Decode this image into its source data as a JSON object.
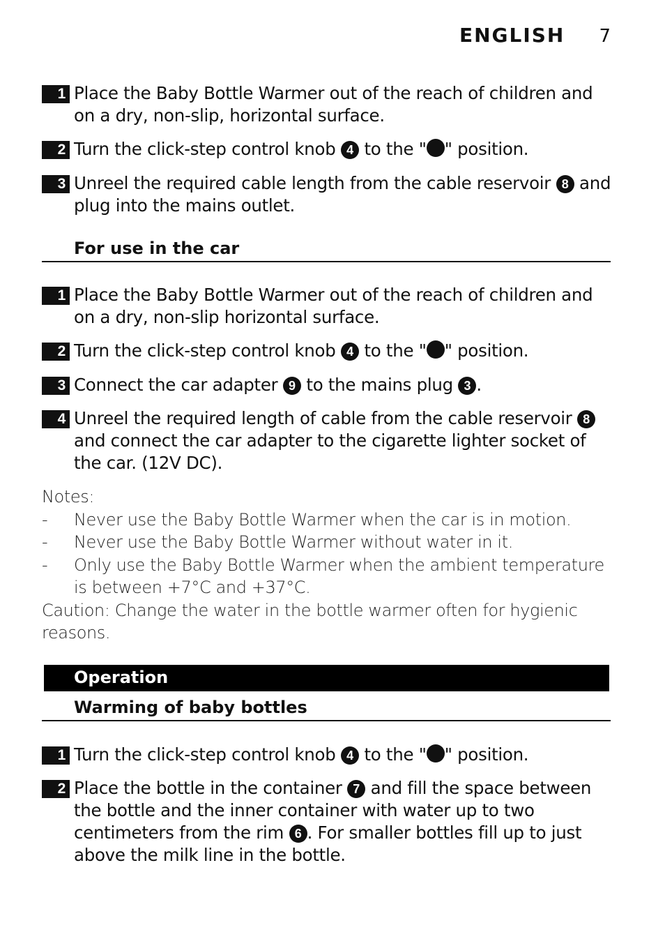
{
  "header": {
    "language": "ENGLISH",
    "page_number": "7"
  },
  "setup_steps": [
    {
      "num": "1",
      "segments": [
        {
          "t": "text",
          "v": "Place the Baby Bottle Warmer out of the reach of children and on a dry, non-slip, horizontal surface."
        }
      ]
    },
    {
      "num": "2",
      "segments": [
        {
          "t": "text",
          "v": "Turn the click-step control knob "
        },
        {
          "t": "circ",
          "v": "4"
        },
        {
          "t": "text",
          "v": " to the \""
        },
        {
          "t": "dot"
        },
        {
          "t": "text",
          "v": "\" position."
        }
      ]
    },
    {
      "num": "3",
      "segments": [
        {
          "t": "text",
          "v": "Unreel the required cable length from the cable reservoir "
        },
        {
          "t": "circ",
          "v": "8"
        },
        {
          "t": "text",
          "v": " and plug into the mains outlet."
        }
      ]
    }
  ],
  "car_section": {
    "heading": "For use in the car",
    "steps": [
      {
        "num": "1",
        "segments": [
          {
            "t": "text",
            "v": "Place the Baby Bottle Warmer out of the reach of children and on a dry, non-slip horizontal surface."
          }
        ]
      },
      {
        "num": "2",
        "segments": [
          {
            "t": "text",
            "v": "Turn the click-step control knob "
          },
          {
            "t": "circ",
            "v": "4"
          },
          {
            "t": "text",
            "v": " to the \""
          },
          {
            "t": "dot"
          },
          {
            "t": "text",
            "v": "\" position."
          }
        ]
      },
      {
        "num": "3",
        "segments": [
          {
            "t": "text",
            "v": "Connect the car adapter "
          },
          {
            "t": "circ",
            "v": "9"
          },
          {
            "t": "text",
            "v": " to the mains plug "
          },
          {
            "t": "circ",
            "v": "3"
          },
          {
            "t": "text",
            "v": "."
          }
        ]
      },
      {
        "num": "4",
        "segments": [
          {
            "t": "text",
            "v": "Unreel the required length of cable from the cable reservoir "
          },
          {
            "t": "circ",
            "v": "8"
          },
          {
            "t": "text",
            "v": " and connect the car adapter to the cigarette lighter socket of the car. (12V DC)."
          }
        ]
      }
    ],
    "notes_label": "Notes:",
    "notes": [
      "Never use the Baby Bottle Warmer when the car is in motion.",
      "Never use the Baby Bottle Warmer without water in it.",
      "Only use the Baby Bottle Warmer when the ambient temperature is between +7°C and +37°C."
    ],
    "bullet_char": "-",
    "caution": "Caution: Change the water in the bottle warmer often for hygienic reasons."
  },
  "operation": {
    "band_title": "Operation",
    "subheading": "Warming of baby bottles",
    "steps": [
      {
        "num": "1",
        "segments": [
          {
            "t": "text",
            "v": "Turn the click-step control knob "
          },
          {
            "t": "circ",
            "v": "4"
          },
          {
            "t": "text",
            "v": " to the \""
          },
          {
            "t": "dot"
          },
          {
            "t": "text",
            "v": "\" position."
          }
        ]
      },
      {
        "num": "2",
        "segments": [
          {
            "t": "text",
            "v": "Place the bottle in the container "
          },
          {
            "t": "circ",
            "v": "7"
          },
          {
            "t": "text",
            "v": " and fill the space between the bottle and the inner container with water up to two centimeters from the rim "
          },
          {
            "t": "circ",
            "v": "6"
          },
          {
            "t": "text",
            "v": ". For smaller bottles fill up to just above the milk line in the bottle."
          }
        ]
      }
    ]
  }
}
